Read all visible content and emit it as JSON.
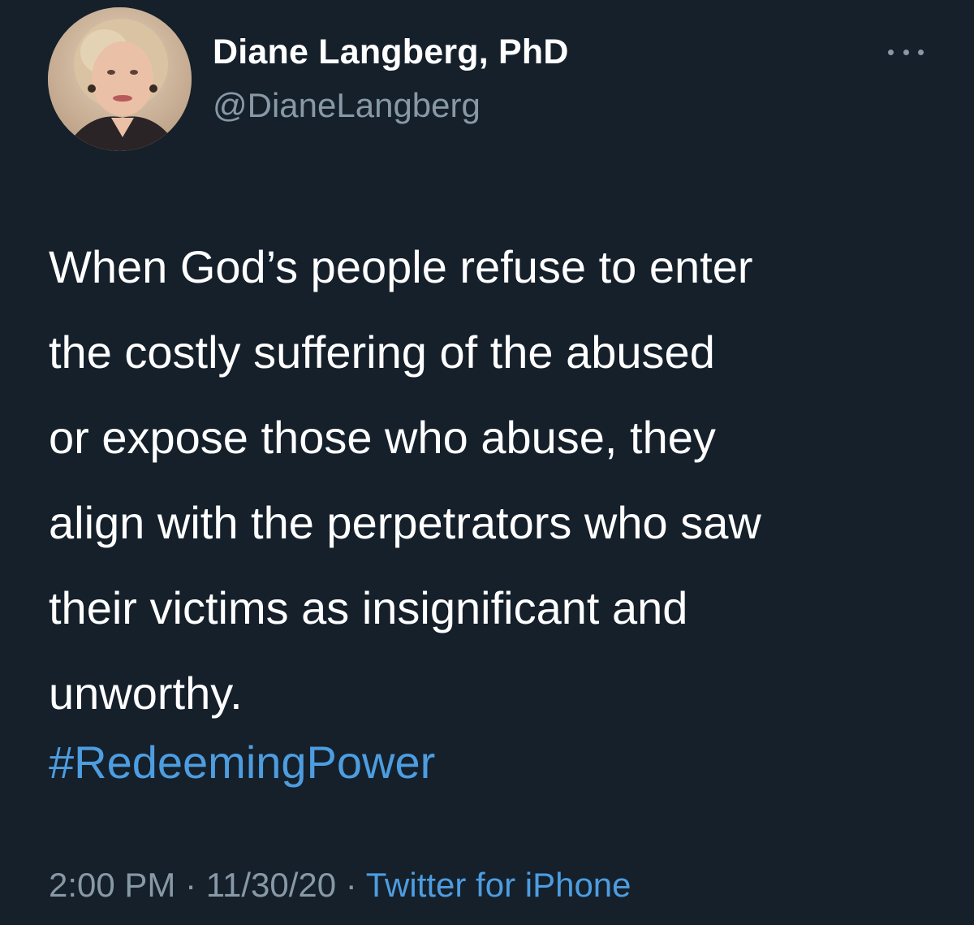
{
  "author": {
    "display_name": "Diane Langberg, PhD",
    "handle": "@DianeLangberg"
  },
  "more_icon": "more-horizontal-icon",
  "tweet": {
    "text": "When God’s people refuse to enter\nthe costly suffering of the abused\nor expose those who abuse, they\nalign with the perpetrators who saw\ntheir victims as insignificant and\nunworthy.",
    "hashtag": "#RedeemingPower"
  },
  "meta": {
    "time": "2:00 PM",
    "separator": " · ",
    "date": "11/30/20",
    "source": "Twitter for iPhone"
  },
  "colors": {
    "background": "#15202b",
    "primary_text": "#ffffff",
    "secondary_text": "#8899a6",
    "accent": "#4d9de0"
  }
}
